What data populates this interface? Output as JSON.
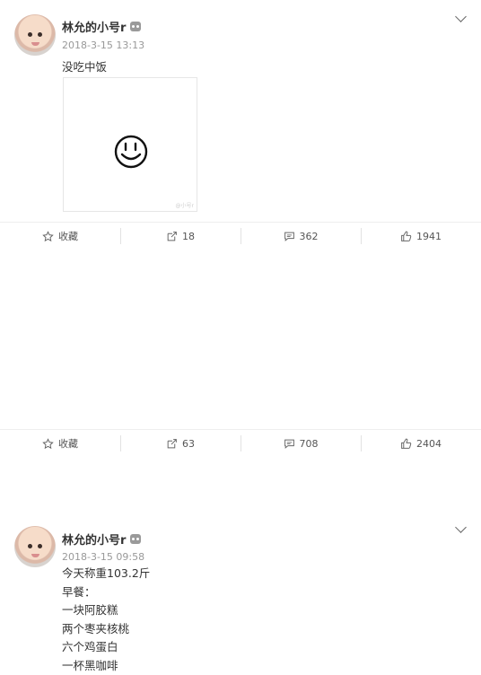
{
  "posts": [
    {
      "username": "林允的小号r",
      "time": "2018-3-15 13:13",
      "text": "没吃中饭",
      "image_watermark": "@小号r",
      "actions": {
        "favorite": "收藏",
        "repost": "18",
        "comment": "362",
        "like": "1941"
      }
    },
    {
      "username": "林允的小号r",
      "time": "2018-3-15 09:58",
      "lines": [
        "今天称重103.2斤",
        "早餐：",
        "一块阿胶糕",
        "两个枣夹核桃",
        "六个鸡蛋白",
        "一杯黑咖啡"
      ],
      "actions": {
        "favorite": "收藏",
        "repost": "63",
        "comment": "708",
        "like": "2404"
      }
    }
  ],
  "icons": [
    "robot-icon",
    "chevron-down-icon",
    "star-icon",
    "repost-icon",
    "comment-icon",
    "thumb-up-icon",
    "smiley-face-image"
  ],
  "colors": {
    "divider": "#e9eef2",
    "divider_accent": "#a9c9e4",
    "meta_text": "#999999"
  }
}
